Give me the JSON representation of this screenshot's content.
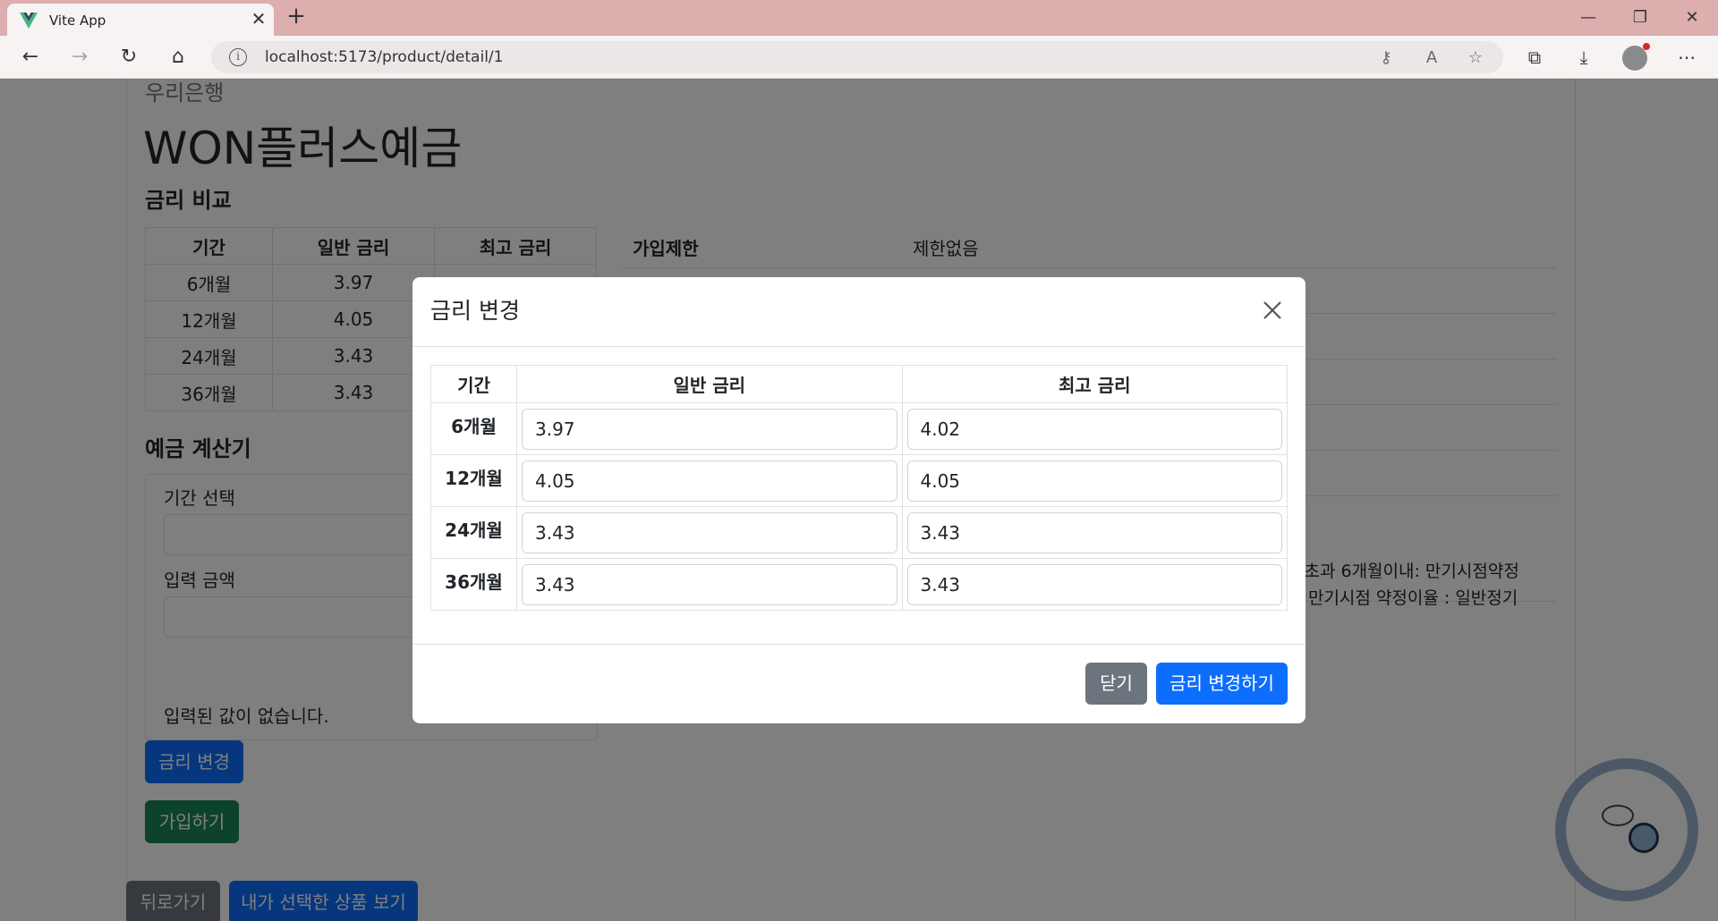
{
  "browser": {
    "tab_title": "Vite App",
    "url": "localhost:5173/product/detail/1"
  },
  "page": {
    "bank_name": "우리은행",
    "product_name": "WON플러스예금",
    "rate_section_title": "금리 비교",
    "rate_table": {
      "headers": [
        "기간",
        "일반 금리",
        "최고 금리"
      ],
      "rows": [
        {
          "period": "6개월",
          "base": "3.97"
        },
        {
          "period": "12개월",
          "base": "4.05"
        },
        {
          "period": "24개월",
          "base": "3.43"
        },
        {
          "period": "36개월",
          "base": "3.43"
        }
      ]
    },
    "info": {
      "join_limit_label": "가입제한",
      "join_limit_value": "제한없음",
      "note_line1": "월초과 6개월이내: 만기시점약정",
      "note_line2": "※ 만기시점 약정이율 : 일반정기"
    },
    "calculator": {
      "title": "예금 계산기",
      "period_label": "기간 선택",
      "amount_label": "입력 금액",
      "empty_message": "입력된 값이 없습니다."
    },
    "buttons": {
      "change_rate": "금리 변경",
      "join": "가입하기",
      "back": "뒤로가기",
      "my_products": "내가 선택한 상품 보기"
    }
  },
  "modal": {
    "title": "금리 변경",
    "headers": [
      "기간",
      "일반 금리",
      "최고 금리"
    ],
    "rows": [
      {
        "period": "6개월",
        "base": "3.97",
        "max": "4.02"
      },
      {
        "period": "12개월",
        "base": "4.05",
        "max": "4.05"
      },
      {
        "period": "24개월",
        "base": "3.43",
        "max": "3.43"
      },
      {
        "period": "36개월",
        "base": "3.43",
        "max": "3.43"
      }
    ],
    "close_label": "닫기",
    "submit_label": "금리 변경하기"
  },
  "colors": {
    "primary": "#0d6efd",
    "success": "#198754",
    "secondary": "#6c757d",
    "tabbar": "#dcaeae"
  }
}
